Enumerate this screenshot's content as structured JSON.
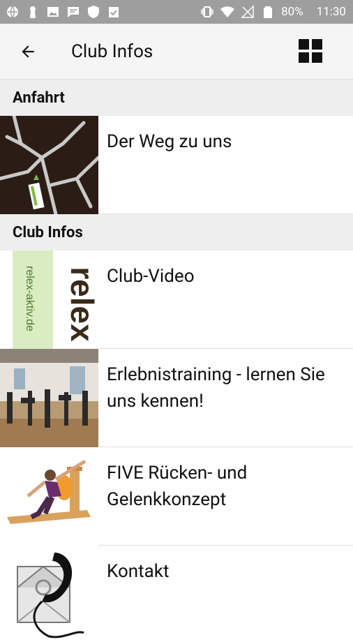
{
  "status_bar": {
    "battery": "80%",
    "time": "11:30"
  },
  "appbar": {
    "title": "Club Infos"
  },
  "sections": [
    {
      "title": "Anfahrt",
      "items": [
        {
          "label": "Der Weg zu uns",
          "thumb": "map"
        }
      ]
    },
    {
      "title": "Club Infos",
      "items": [
        {
          "label": "Club-Video",
          "thumb": "relex-logo",
          "thumb_text": "relex",
          "thumb_site": "relex-aktiv.de"
        },
        {
          "label": "Erlebnistraining - lernen Sie uns kennen!",
          "thumb": "gym"
        },
        {
          "label": "FIVE Rücken- und Gelenkkonzept",
          "thumb": "exercise"
        },
        {
          "label": "Kontakt",
          "thumb": "contact"
        }
      ]
    }
  ]
}
